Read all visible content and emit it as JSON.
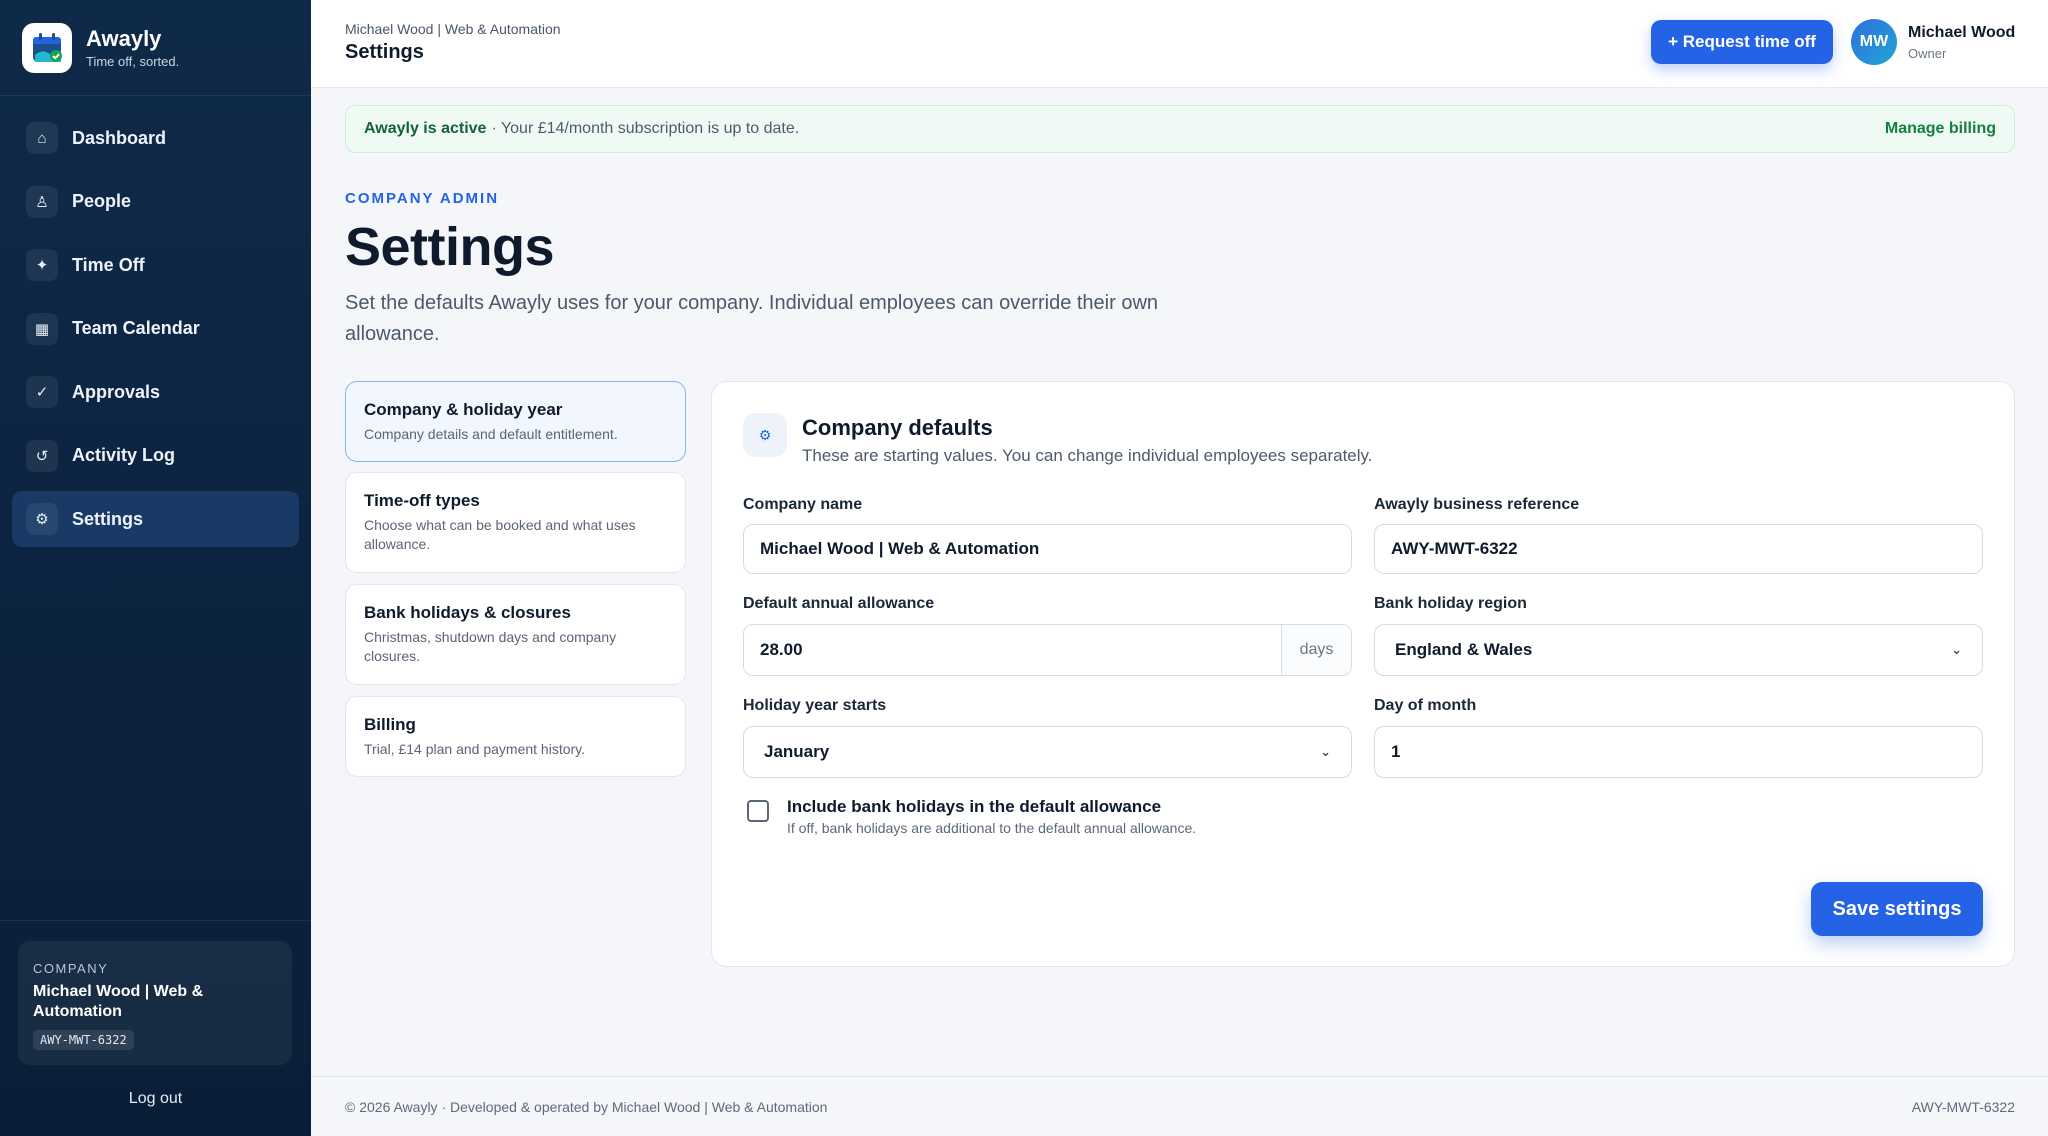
{
  "brand": {
    "name": "Awayly",
    "tagline": "Time off, sorted.",
    "icon": "calendar-check-logo-icon"
  },
  "sidebar": {
    "items": [
      {
        "label": "Dashboard",
        "icon": "home-icon",
        "glyph": "⌂"
      },
      {
        "label": "People",
        "icon": "people-icon",
        "glyph": "♙"
      },
      {
        "label": "Time Off",
        "icon": "sparkle-icon",
        "glyph": "✦"
      },
      {
        "label": "Team Calendar",
        "icon": "calendar-icon",
        "glyph": "▦"
      },
      {
        "label": "Approvals",
        "icon": "check-icon",
        "glyph": "✓"
      },
      {
        "label": "Activity Log",
        "icon": "history-icon",
        "glyph": "↺"
      },
      {
        "label": "Settings",
        "icon": "settings-icon",
        "glyph": "⚙",
        "active": true
      }
    ],
    "company": {
      "kicker": "COMPANY",
      "name": "Michael Wood | Web & Automation",
      "ref": "AWY-MWT-6322"
    },
    "logout": "Log out"
  },
  "header": {
    "breadcrumb": "Michael Wood | Web & Automation",
    "title": "Settings",
    "request_button": "+ Request time off",
    "user": {
      "initials": "MW",
      "name": "Michael Wood",
      "role": "Owner"
    }
  },
  "banner": {
    "strong": "Awayly is active",
    "text": "· Your £14/month subscription is up to date.",
    "link": "Manage billing"
  },
  "page": {
    "kicker": "COMPANY ADMIN",
    "title": "Settings",
    "description": "Set the defaults Awayly uses for your company. Individual employees can override their own allowance."
  },
  "tabs": [
    {
      "title": "Company & holiday year",
      "desc": "Company details and default entitlement.",
      "active": true
    },
    {
      "title": "Time-off types",
      "desc": "Choose what can be booked and what uses allowance."
    },
    {
      "title": "Bank holidays & closures",
      "desc": "Christmas, shutdown days and company closures."
    },
    {
      "title": "Billing",
      "desc": "Trial, £14 plan and payment history."
    }
  ],
  "form": {
    "title": "Company defaults",
    "subtitle": "These are starting values. You can change individual employees separately.",
    "company_name": {
      "label": "Company name",
      "value": "Michael Wood | Web & Automation"
    },
    "business_ref": {
      "label": "Awayly business reference",
      "value": "AWY-MWT-6322"
    },
    "allowance": {
      "label": "Default annual allowance",
      "value": "28.00",
      "suffix": "days"
    },
    "region": {
      "label": "Bank holiday region",
      "value": "England & Wales"
    },
    "year_start": {
      "label": "Holiday year starts",
      "value": "January"
    },
    "day_of_month": {
      "label": "Day of month",
      "value": "1"
    },
    "include_bank_holidays": {
      "label": "Include bank holidays in the default allowance",
      "desc": "If off, bank holidays are additional to the default annual allowance.",
      "checked": false
    },
    "save_button": "Save settings"
  },
  "footer": {
    "left": "© 2026 Awayly · Developed & operated by Michael Wood | Web & Automation",
    "right": "AWY-MWT-6322"
  },
  "colors": {
    "accent": "#2463e6",
    "sidebar": "#0c2340",
    "success": "#15803d"
  }
}
